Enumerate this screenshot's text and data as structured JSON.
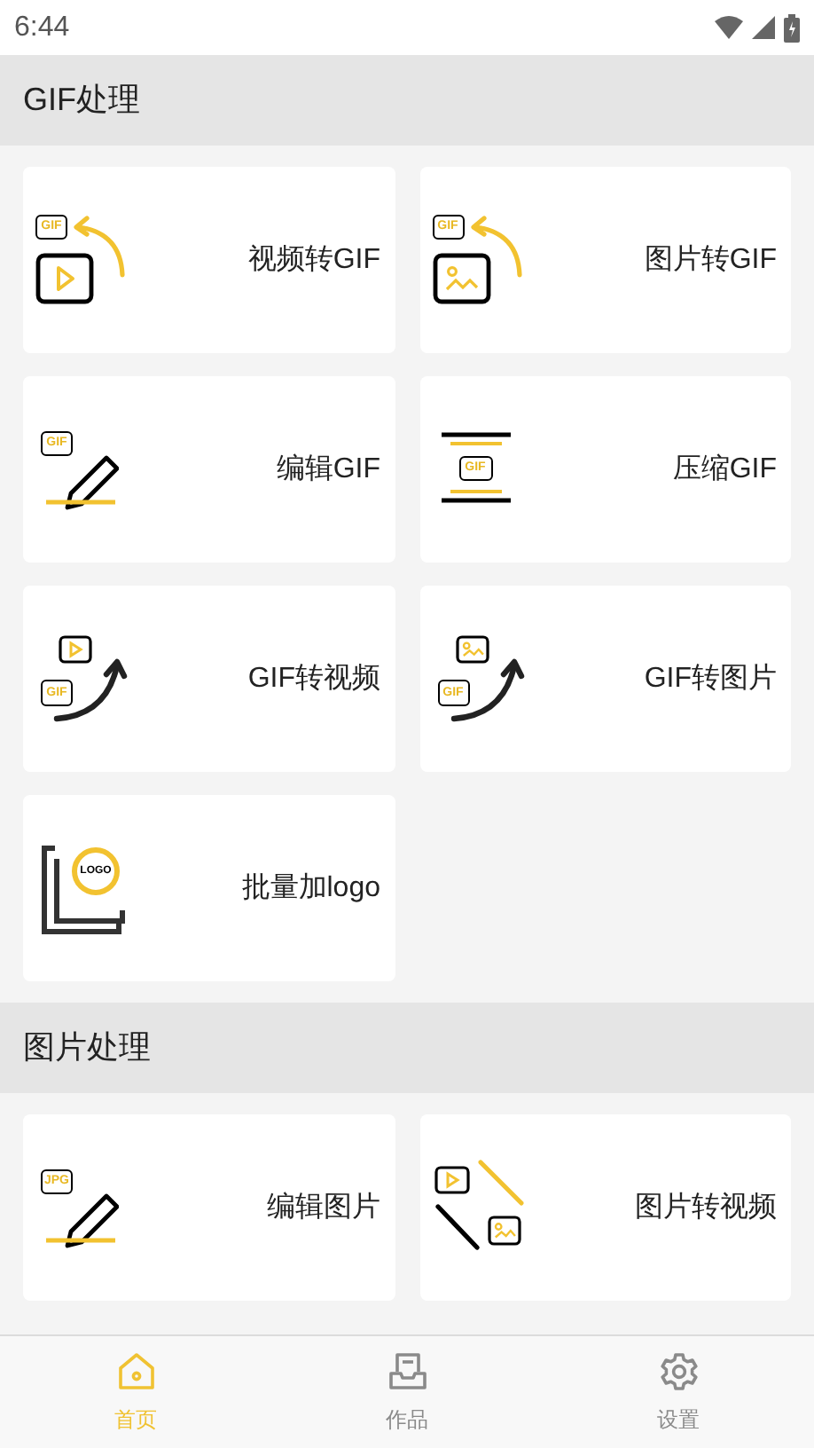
{
  "status_bar": {
    "time": "6:44"
  },
  "sections": [
    {
      "title": "GIF处理",
      "tools": [
        {
          "label": "视频转GIF",
          "kind": "video_to_gif",
          "tag": "GIF"
        },
        {
          "label": "图片转GIF",
          "kind": "image_to_gif",
          "tag": "GIF"
        },
        {
          "label": "编辑GIF",
          "kind": "edit",
          "tag": "GIF"
        },
        {
          "label": "压缩GIF",
          "kind": "compress",
          "tag": "GIF"
        },
        {
          "label": "GIF转视频",
          "kind": "gif_to_video",
          "tag": "GIF"
        },
        {
          "label": "GIF转图片",
          "kind": "gif_to_image",
          "tag": "GIF"
        },
        {
          "label": "批量加logo",
          "kind": "logo",
          "tag": "LOGO"
        }
      ]
    },
    {
      "title": "图片处理",
      "tools": [
        {
          "label": "编辑图片",
          "kind": "edit",
          "tag": "JPG"
        },
        {
          "label": "图片转视频",
          "kind": "image_to_video"
        }
      ]
    }
  ],
  "nav": [
    {
      "label": "首页",
      "kind": "home",
      "selected": true
    },
    {
      "label": "作品",
      "kind": "works",
      "selected": false
    },
    {
      "label": "设置",
      "kind": "settings",
      "selected": false
    }
  ]
}
